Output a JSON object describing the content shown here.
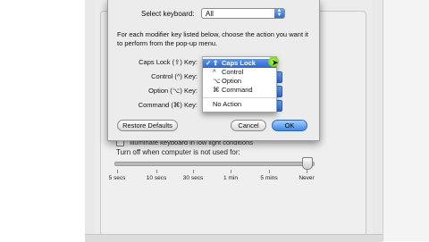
{
  "background": {
    "checkbox_label": "Illuminate keyboard in low light conditions",
    "turn_off_label": "Turn off when computer is not used for:",
    "slider_value": "Never",
    "slider_ticks": [
      "5 secs",
      "10 secs",
      "30 secs",
      "1 min",
      "5 mins",
      "Never"
    ]
  },
  "dialog": {
    "select_label": "Select keyboard:",
    "select_value": "All",
    "description": "For each modifier key listed below, choose the action you want it to perform from the pop-up menu.",
    "keys": [
      {
        "label": "Caps Lock (⇪) Key:"
      },
      {
        "label": "Control (^) Key:"
      },
      {
        "label": "Option (⌥) Key:"
      },
      {
        "label": "Command (⌘) Key:"
      }
    ],
    "restore_label": "Restore Defaults",
    "cancel_label": "Cancel",
    "ok_label": "OK"
  },
  "menu": {
    "items": [
      {
        "check": "✓",
        "symbol": "⇪",
        "label": "Caps Lock"
      },
      {
        "check": "",
        "symbol": "^",
        "label": "Control"
      },
      {
        "check": "",
        "symbol": "⌥",
        "label": "Option"
      },
      {
        "check": "",
        "symbol": "⌘",
        "label": "Command"
      },
      {
        "check": "",
        "symbol": "",
        "label": "No Action"
      }
    ]
  },
  "colors": {
    "accent": "#3d89ea",
    "highlight": "#2d66cf",
    "cursor_glow": "#7fdc18"
  }
}
